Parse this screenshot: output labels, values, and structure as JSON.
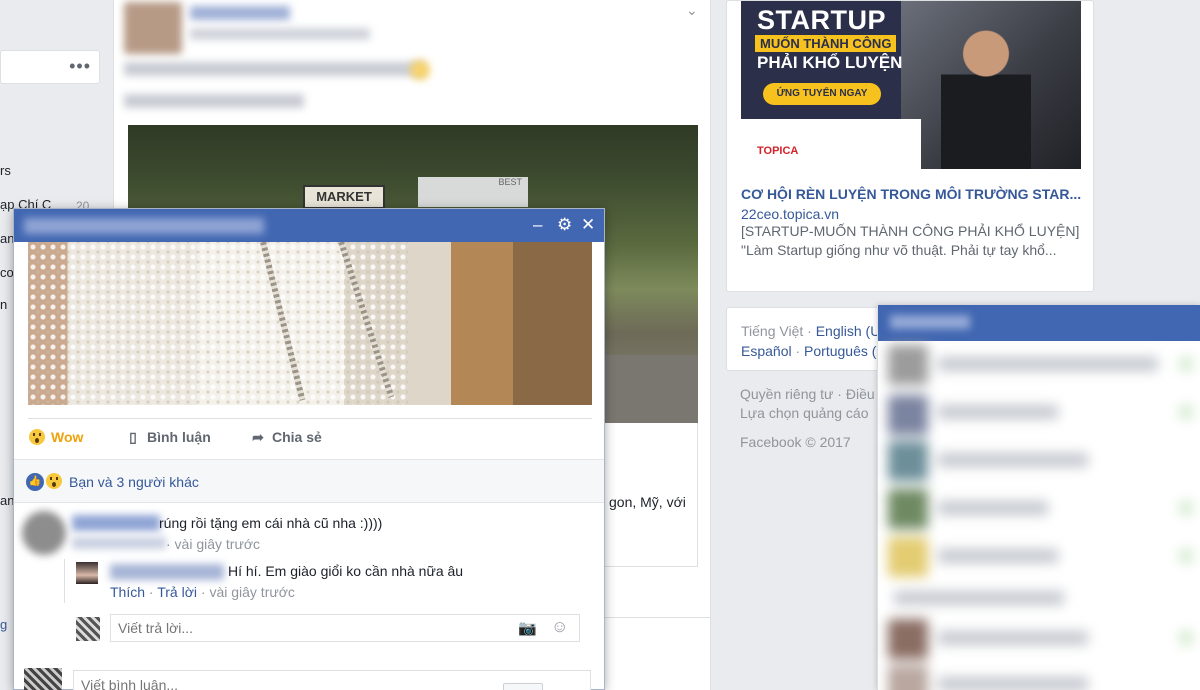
{
  "left_sidebar": {
    "more": "•••",
    "items": [
      "rs",
      "ạp Chí C",
      "an",
      "co",
      "n",
      "an"
    ],
    "count": "20",
    "link": "g"
  },
  "post": {
    "photo_sign": "MARKET",
    "photo_sign2": "BEST",
    "snippet": "gon, Mỹ, với"
  },
  "ad": {
    "title": "STARTUP",
    "subtitle1": "MUỐN THÀNH CÔNG",
    "subtitle2": "PHẢI KHỔ LUYỆN",
    "cta": "ỨNG TUYỂN NGAY",
    "brand": "TOPICA",
    "headline": "CƠ HỘI RÈN LUYỆN TRONG MÔI TRƯỜNG STAR...",
    "domain": "22ceo.topica.vn",
    "description": "[STARTUP-MUỐN THÀNH CÔNG PHẢI KHỔ LUYỆN] \"Làm Startup giống như võ thuật. Phải tự tay khổ..."
  },
  "languages": {
    "current": "Tiếng Việt",
    "sep": " · ",
    "english": "English (U",
    "spanish": "Español",
    "portuguese": "Português ("
  },
  "footer": {
    "line1": "Quyền riêng tư · Điều",
    "line2": "Lựa chọn quảng cáo",
    "copyright": "Facebook © 2017"
  },
  "popup": {
    "minimize": "–",
    "settings": "⚙",
    "close": "✕",
    "actions": {
      "wow": "Wow",
      "comment": "Bình luận",
      "share": "Chia sẻ"
    },
    "reactions_text": "Bạn và 3 người khác",
    "comment": {
      "text": "rúng rồi tặng em cái nhà cũ nha :))))",
      "meta": " · vài giây trước"
    },
    "reply": {
      "text": "Hí hí. Em giào giổi ko cần nhà nữa âu",
      "like": "Thích",
      "reply": "Trả lời",
      "time": " · vài giây trước"
    },
    "reply_placeholder": "Viết trả lời..."
  },
  "bottom_comment_placeholder": "Viết bình luận...",
  "colors": {
    "facebook_blue": "#4267b2",
    "link_blue": "#365899",
    "wow_yellow": "#f7b928"
  }
}
